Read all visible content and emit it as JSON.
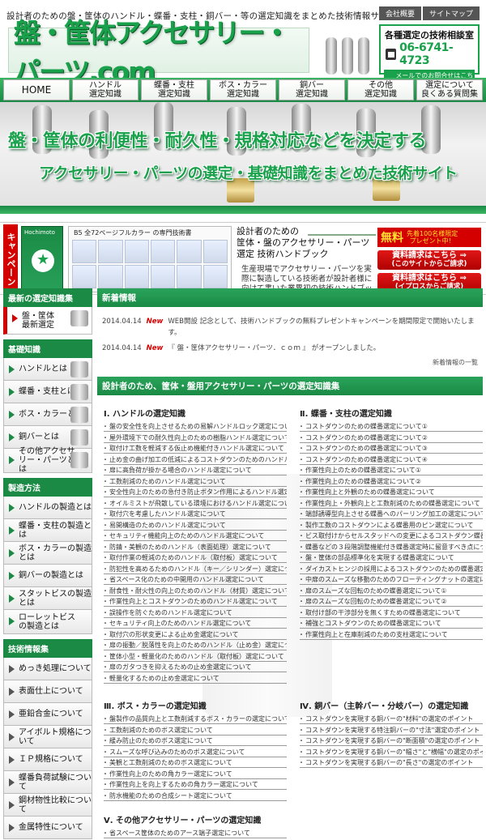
{
  "header": {
    "tagline": "設計者のための盤・筐体のハンドル・蝶番・支柱・銅バー・等の選定知識をまとめた技術情報サイト",
    "util_links": [
      "会社概要",
      "サイトマップ"
    ],
    "logo": "盤・筐体アクセサリー・パーツ.com",
    "contact": {
      "title": "各種選定の技術相談室",
      "phone": "06-6741-4723",
      "mail": "メールでのお問合せはこちら"
    }
  },
  "nav": [
    "HOME",
    "ハンドル\n選定知識",
    "蝶番・支柱\n選定知識",
    "ボス・カラー\n選定知識",
    "銅バー\n選定知識",
    "その他\n選定知識",
    "選定について\n良くある質問集"
  ],
  "hero": {
    "line1": "盤・筐体の利便性・耐久性・規格対応などを決定する",
    "line2": "アクセサリー・パーツの選定・基礎知識をまとめた技術サイト"
  },
  "campaign": {
    "tab": "キャンペーン",
    "book_title": "Hochimoto",
    "brochure_caption": "B5 全72ページフルカラー の専門技術書",
    "text1": "設計者のための",
    "text2": "筐体・盤のアクセサリー・パーツ",
    "text2b": "選定 技術ハンドブック",
    "text3": "生産現場でアクセサリー・パーツを実際に製造している技術者が設計者様に向けて書いた業界初の技術ハンドブックです。",
    "free": "無料",
    "free_sub": "先着100名様限定\nプレゼント中！",
    "req1": "資料請求はこちら ⇒",
    "req1_sub": "(このサイトからご請求)",
    "req2": "資料請求はこちら ⇒",
    "req2_sub": "(イプロスからご請求)"
  },
  "sidebar": {
    "latest_header": "最新の選定知識集",
    "latest_item": "盤・筐体\n最新選定",
    "basics_header": "基礎知識",
    "basics": [
      "ハンドルとは",
      "蝶番・支柱とは",
      "ボス・カラーとは",
      "銅バーとは",
      "その他アクセサリー・パーツとは"
    ],
    "method_header": "製造方法",
    "method": [
      "ハンドルの製造とは",
      "蝶番・支柱の製造とは",
      "ボス・カラーの製造とは",
      "銅バーの製造とは",
      "スタットビスの製造とは",
      "ローレットビスの製造とは"
    ],
    "tech_header": "技術情報集",
    "tech": [
      "めっき処理について",
      "表面仕上について",
      "亜鉛合金について",
      "アイボルト規格について",
      "ＩＰ規格について",
      "蝶番負荷試験について",
      "鋼材物性比較について",
      "金属特性について"
    ]
  },
  "news": {
    "header": "新着情報",
    "items": [
      {
        "date": "2014.04.14",
        "tag": "New",
        "text": "WEB開設 記念として、技術ハンドブックの無料プレゼントキャンペーンを期間限定で開始いたします。"
      },
      {
        "date": "2014.04.14",
        "tag": "New",
        "text": "『 盤・筐体アクセサリー・パーツ．ｃｏｍ 』 がオープンしました。"
      }
    ],
    "more": "新着情報の一覧"
  },
  "knowledge": {
    "header": "設計者のため、筐体・盤用アクセサリー・パーツの選定知識集",
    "col1_title": "Ⅰ. ハンドルの選定知識",
    "col1": [
      "盤の安全性を向上させるための易解ハンドルロック選定について",
      "屋外環境下での耐久性向上のための樹脂ハンドル選定について",
      "取付け工数を軽減する仮止め機能付きハンドル選定について",
      "止め金の曲げ加工の低減によるコストダウンのためのハンドル選定について",
      "扉に高負荷が掛かる場合のハンドル選定について",
      "工数削減のためのハンドル選定について",
      "安全性向上のための急付き防止ボタン作用によるハンドル選定について",
      "オイルミストが飛散している環境におけるハンドル選定について",
      "取付穴を考慮したハンドル選定について",
      "易開構造のためのハンドル選定について",
      "セキュリティ機能向上のためのハンドル選定について",
      "防錆・美観のためのハンドル（表面処理）選定について",
      "取付作業の軽減のためのハンドル（取付板）選定について",
      "防犯性を高めるためのハンドル（キー／シリンダー）選定について",
      "省スペース化のための中開用のハンドル選定について",
      "耐食性・耐火性の向上のためのハンドル（材質）選定について",
      "作業性向上とコストダウンのためのハンドル選定について",
      "誤操作を防ぐためのハンドル選定について",
      "セキュリティ向上のためのハンドル選定について",
      "取付穴の形状変更による止め金選定について",
      "扉の振動／脱落性を向上のためのハンドル（止め金）選定について",
      "筐体小型・軽量化のためのハンドル（取付板）選定について",
      "扉のガタつきを抑えるための止め金選定について",
      "軽量化するための止め金選定について"
    ],
    "col2_title": "Ⅱ. 蝶番・支柱の選定知識",
    "col2": [
      "コストダウンのための蝶番選定について①",
      "コストダウンのための蝶番選定について②",
      "コストダウンのための蝶番選定について③",
      "コストダウンのための蝶番選定について④",
      "作業性向上のための蝶番選定について①",
      "作業性向上のための蝶番選定について②",
      "作業性向上と外観のための蝶番選定について",
      "作業性向上・外観向上と工数削減のための蝶番選定について",
      "端部誘導型向上させる蝶番へのパーリング加工の選定について",
      "製作工数のコストダウンによる蝶番用のピン選定について",
      "ビス取付けからセルスタッドへの変更によるコストダウン蝶番選定について",
      "蝶番などの３段階調整機能付き蝶番選定時に留意すべき点について",
      "盤・筐体の部品標準化を実現する蝶番選定について",
      "ダイカストヒンジの採用によるコストダウンのための蝶番選定について",
      "中扉のスムーズな移動のためのフローティングナットの選定について",
      "扉のスムーズな回転のための蝶番選定について①",
      "扉のスムーズな回転のための蝶番選定について②",
      "取付け部の干渉部分を無くすための蝶番選定について",
      "補強とコストダウンのための蝶番選定について",
      "作業性向上と在庫削減のための支柱選定について"
    ],
    "col3_title": "Ⅲ. ボス・カラーの選定知識",
    "col3": [
      "盤製作の品質向上と工数削減するボス・カラーの選定について",
      "工数削減のためのボス選定について",
      "緩み防止のためのボス選定について",
      "スムーズな呼び込みのためのボス選定について",
      "美観と工数削減のためのボス選定について",
      "作業性向上のための角カラー選定について",
      "作業性向上を向上するための角カラー選定について",
      "防水機能のための合成シート選定について"
    ],
    "col4_title": "Ⅳ. 銅バー（主幹バー・分岐バー）の選定知識",
    "col4": [
      "コストダウンを実現する銅バーの\"材料\"の選定のポイント",
      "コストダウンを実現する特注銅バーの\"寸法\"選定のポイント",
      "コストダウンを実現する銅バーの\"断面積\"の選定のポイント",
      "コストダウンを実現する銅バーの\"幅さ\"と\"横幅\"の選定のポイント",
      "コストダウンを実現する銅バーの\"長さ\"の選定のポイント"
    ],
    "col5_title": "Ⅴ. その他アクセサリー・パーツの選定知識",
    "col5": [
      "省スペース筐体のためのアース端子選定について"
    ]
  }
}
